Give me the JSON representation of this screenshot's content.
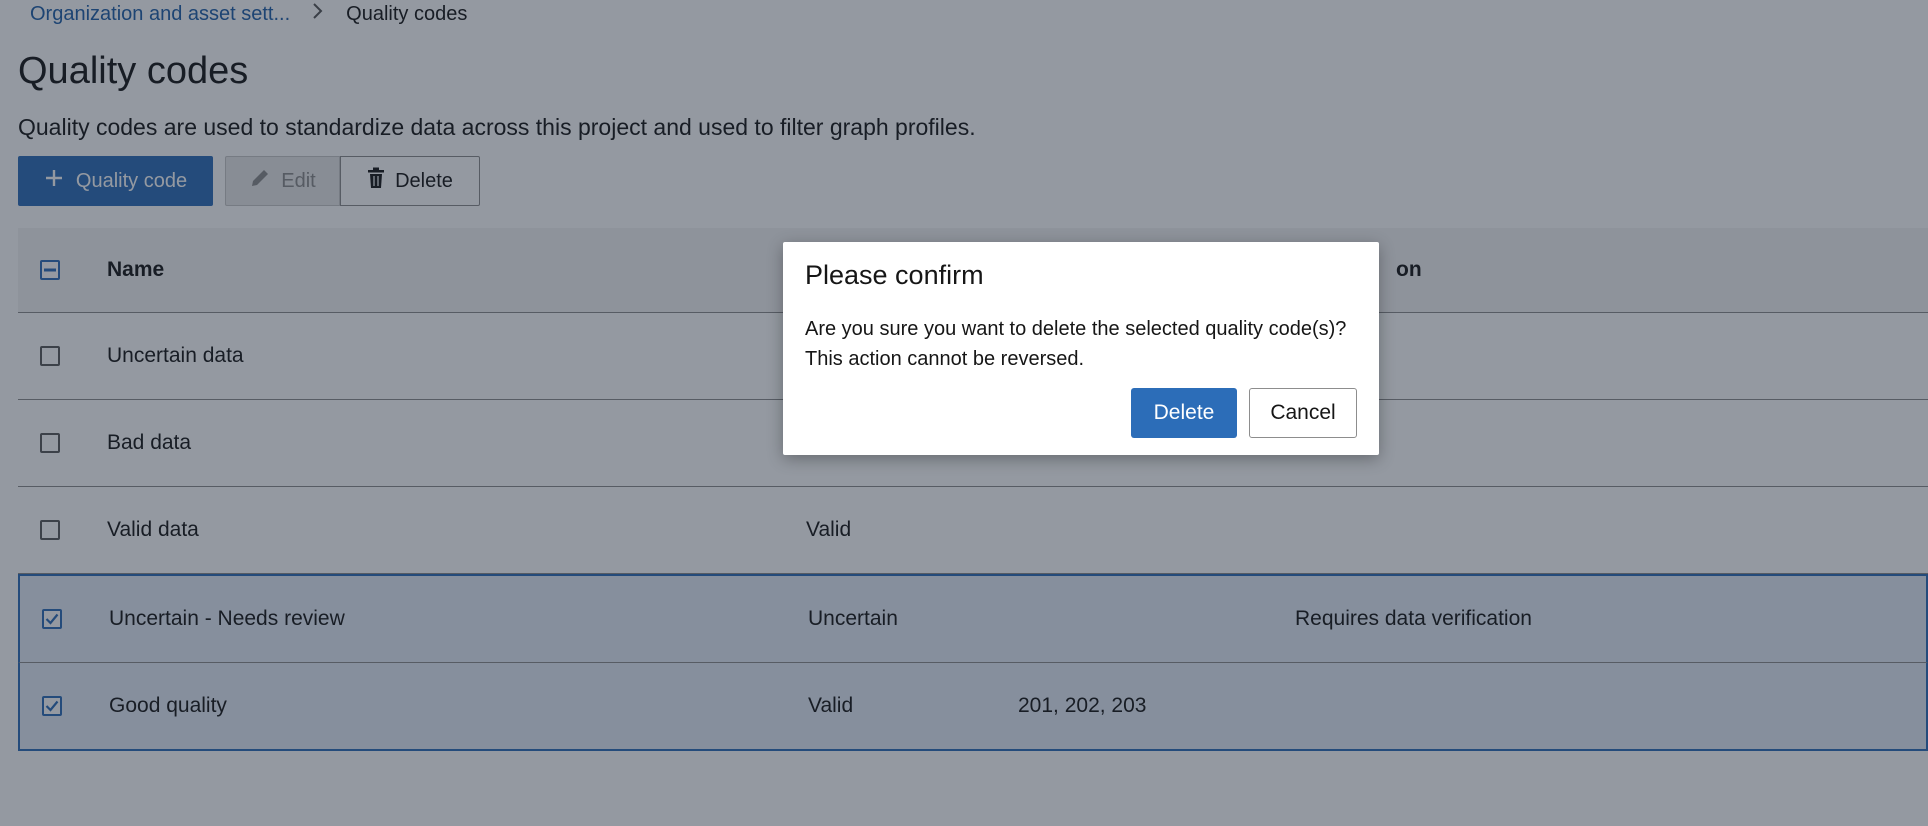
{
  "breadcrumb": {
    "parent": "Organization and asset sett...",
    "current": "Quality codes"
  },
  "page": {
    "title": "Quality codes",
    "description": "Quality codes are used to standardize data across this project and used to filter graph profiles."
  },
  "toolbar": {
    "add_label": "Quality code",
    "edit_label": "Edit",
    "delete_label": "Delete"
  },
  "table": {
    "columns": {
      "name": "Name",
      "description": "on"
    },
    "rows": [
      {
        "name": "Uncertain data",
        "status": "",
        "codes": "",
        "description": "",
        "selected": false
      },
      {
        "name": "Bad data",
        "status": "",
        "codes": "",
        "description": "",
        "selected": false
      },
      {
        "name": "Valid data",
        "status": "Valid",
        "codes": "",
        "description": "",
        "selected": false
      },
      {
        "name": "Uncertain - Needs review",
        "status": "Uncertain",
        "codes": "",
        "description": "Requires data verification",
        "selected": true
      },
      {
        "name": "Good quality",
        "status": "Valid",
        "codes": "201, 202, 203",
        "description": "",
        "selected": true
      }
    ]
  },
  "dialog": {
    "title": "Please confirm",
    "line1": "Are you sure you want to delete the selected quality code(s)?",
    "line2": "This action cannot be reversed.",
    "confirm_label": "Delete",
    "cancel_label": "Cancel"
  },
  "colors": {
    "accent": "#2c6db8",
    "link": "#1f5fa8",
    "selected_row": "#e5ecf7"
  }
}
